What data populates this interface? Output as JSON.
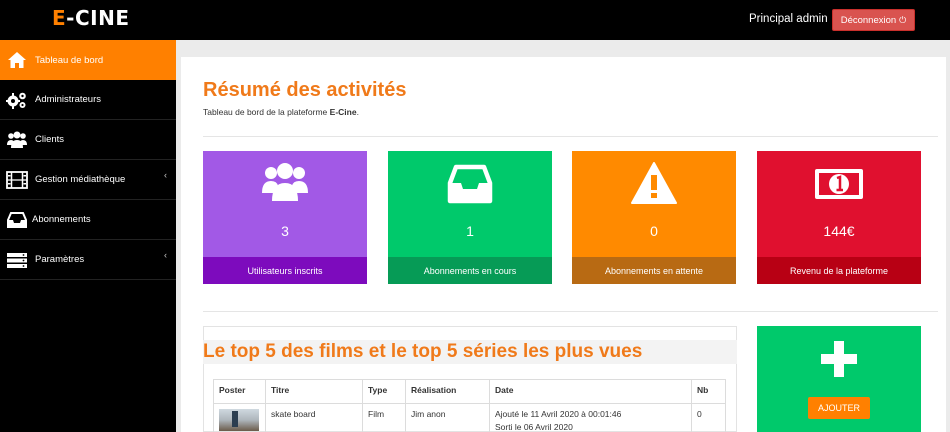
{
  "app": {
    "logo_e": "E",
    "logo_rest": "-CINE"
  },
  "header": {
    "admin_name": "Principal admin",
    "logout_label": "Déconnexion"
  },
  "sidebar": {
    "items": [
      {
        "label": "Tableau de bord",
        "icon": "home-icon"
      },
      {
        "label": "Administrateurs",
        "icon": "gears-icon"
      },
      {
        "label": "Clients",
        "icon": "users-icon"
      },
      {
        "label": "Gestion médiathèque",
        "icon": "film-icon"
      },
      {
        "label": "Abonnements",
        "icon": "inbox-icon"
      },
      {
        "label": "Paramètres",
        "icon": "server-icon"
      }
    ]
  },
  "main": {
    "title": "Résumé des activités",
    "subtitle_prefix": "Tableau de bord de la plateforme ",
    "subtitle_brand": "E-Cine",
    "subtitle_suffix": "."
  },
  "stats": [
    {
      "value": "3",
      "label": "Utilisateurs inscrits",
      "icon": "users-icon",
      "color": "#a259e6",
      "foot_color": "#7d0bbd"
    },
    {
      "value": "1",
      "label": "Abonnements en cours",
      "icon": "inbox-icon",
      "color": "#00c96b",
      "foot_color": "#069b56"
    },
    {
      "value": "0",
      "label": "Abonnements en attente",
      "icon": "warning-icon",
      "color": "#ff8a00",
      "foot_color": "#b86a13"
    },
    {
      "value": "144€",
      "label": "Revenu de la plateforme",
      "icon": "money-icon",
      "color": "#e0102f",
      "foot_color": "#b80014"
    }
  ],
  "top5": {
    "title": "Le top 5 des films et le top 5 séries les plus vues",
    "headers": [
      "Poster",
      "Titre",
      "Type",
      "Réalisation",
      "Date",
      "Nb"
    ],
    "rows": [
      {
        "title": "skate board",
        "type": "Film",
        "director": "Jim anon",
        "date_added": "Ajouté le 11 Avril 2020 à 00:01:46",
        "date_released": "Sorti le 06 Avril 2020",
        "nb": "0"
      }
    ]
  },
  "add_card": {
    "button_label": "AJOUTER",
    "icon": "plus-icon"
  }
}
